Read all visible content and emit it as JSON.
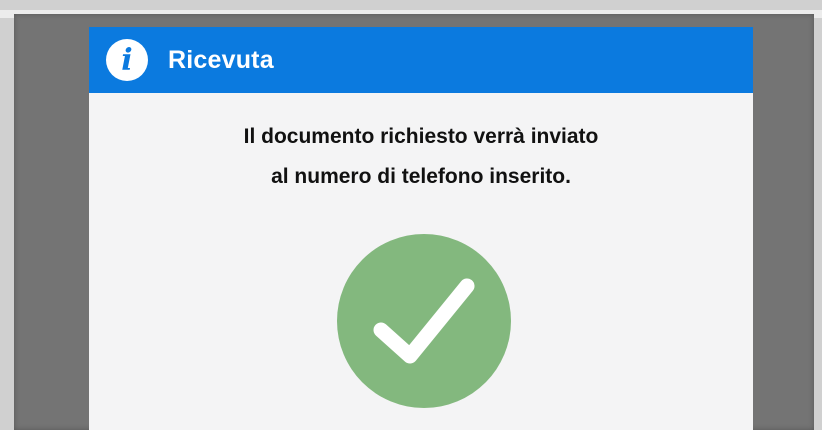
{
  "dialog": {
    "title": "Ricevuta",
    "header_color": "#0b7adf",
    "icon": "info-icon",
    "message_line1": "Il documento richiesto verrà inviato",
    "message_line2": "al numero di telefono inserito.",
    "status_icon": "checkmark-circle-icon",
    "status_color": "#83b87e"
  }
}
